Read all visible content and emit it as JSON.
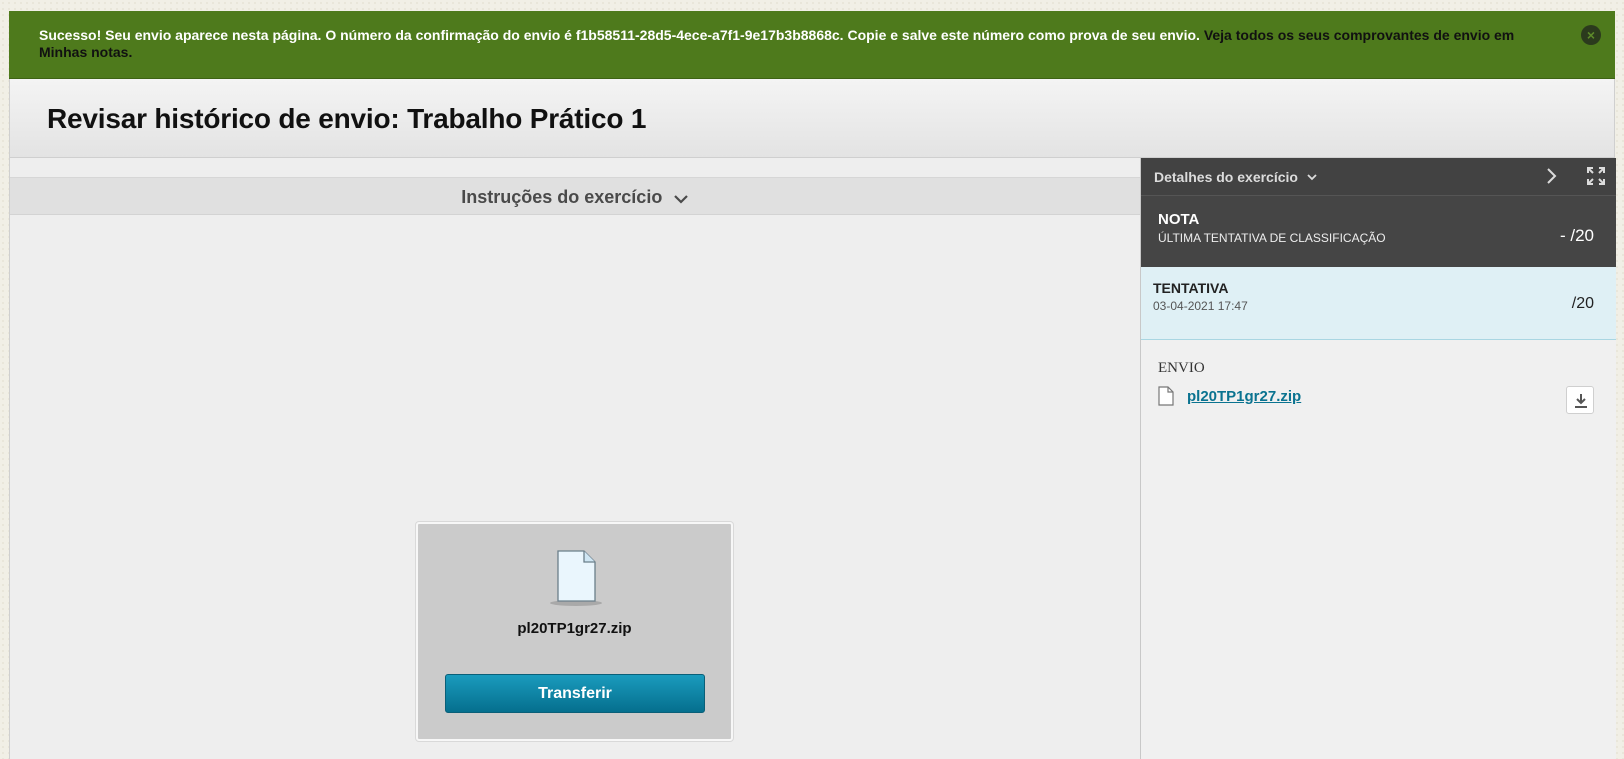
{
  "banner": {
    "message": "Sucesso! Seu envio aparece nesta página. O número da confirmação do envio é f1b58511-28d5-4ece-a7f1-9e17b3b8868c. Copie e salve este número como prova de seu envio. ",
    "link_text": "Veja todos os seus comprovantes de envio em Minhas notas.",
    "close_icon": "×"
  },
  "page": {
    "title": "Revisar histórico de envio: Trabalho Prático 1"
  },
  "instructions": {
    "label": "Instruções do exercício"
  },
  "file_card": {
    "filename": "pl20TP1gr27.zip",
    "button_label": "Transferir"
  },
  "sidebar": {
    "title": "Detalhes do exercício",
    "grade": {
      "label": "NOTA",
      "sub_label": "ÚLTIMA TENTATIVA DE CLASSIFICAÇÃO",
      "score": "- /20"
    },
    "attempt": {
      "label": "TENTATIVA",
      "date": "03-04-2021 17:47",
      "score": "/20"
    },
    "submission": {
      "label": "ENVIO",
      "filename": "pl20TP1gr27.zip"
    }
  },
  "colors": {
    "banner_bg": "#4e7a1c",
    "button_bg": "#0a84a6",
    "link": "#0a7390",
    "sidebar_dark": "#424242",
    "attempt_bg": "#dff0f5"
  }
}
